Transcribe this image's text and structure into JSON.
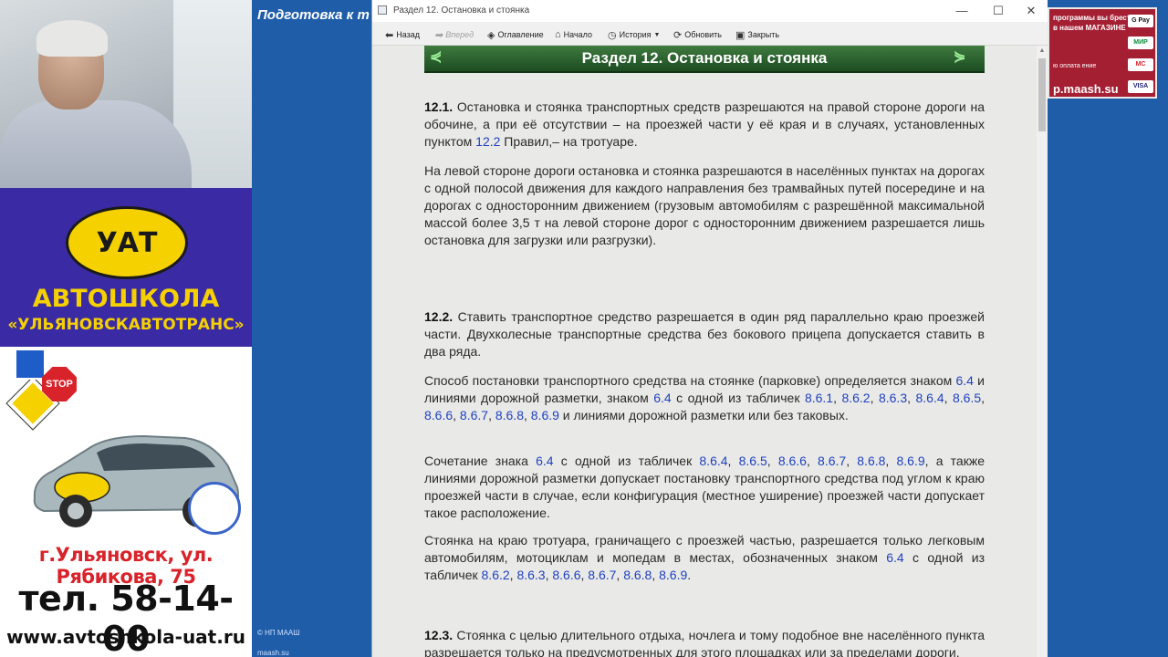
{
  "ad": {
    "logo_text": "УАТ",
    "title1": "АВТОШКОЛА",
    "title2": "«УЛЬЯНОВСКАВТОТРАНС»",
    "stop_sign": "STOP",
    "address": "г.Ульяновск, ул. Рябикова, 75",
    "phone": "тел. 58-14-00",
    "site": "www.avtoshkola-uat.ru"
  },
  "background_app": {
    "title": "Подготовка к т",
    "copyright": "© НП МААШ",
    "link": "maash.su"
  },
  "right_ad": {
    "line1": "программы вы брести в нашем МАГАЗИНЕ",
    "line2": "ю оплата ение",
    "site": "p.maash.su",
    "pay": [
      "G Pay",
      "МИР",
      "MC",
      "VISA"
    ]
  },
  "window": {
    "title": "Раздел 12. Остановка и стоянка",
    "buttons": {
      "minimize": "—",
      "maximize": "☐",
      "close": "✕"
    }
  },
  "toolbar": {
    "back": "Назад",
    "forward": "Вперед",
    "contents": "Оглавление",
    "home": "Начало",
    "history": "История",
    "refresh": "Обновить",
    "close": "Закрыть"
  },
  "section": {
    "heading": "Раздел 12. Остановка и стоянка",
    "prev": "⋞",
    "next": "⋟"
  }
}
